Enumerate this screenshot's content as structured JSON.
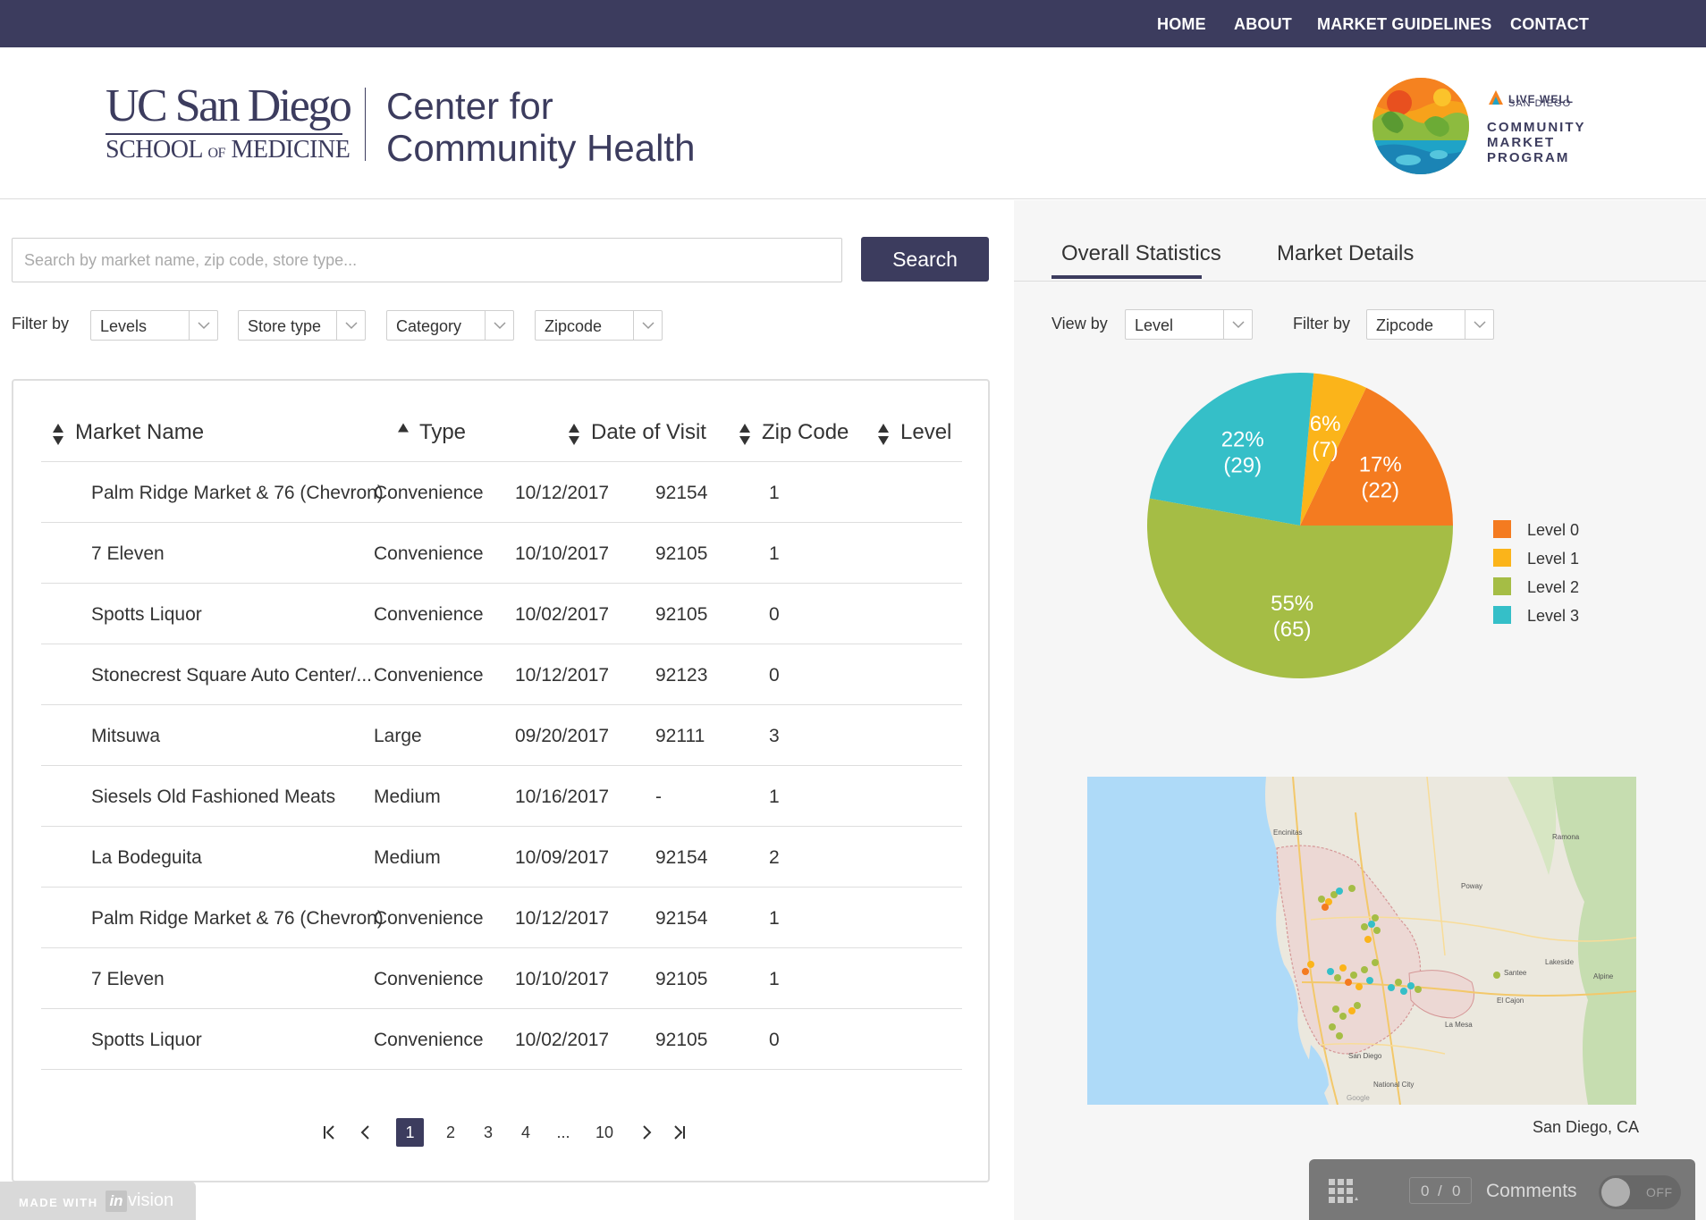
{
  "nav": {
    "items": [
      "HOME",
      "ABOUT",
      "MARKET GUIDELINES",
      "CONTACT"
    ]
  },
  "header": {
    "ucsd_title": "UC San Diego",
    "ucsd_sub_1": "SCHOOL",
    "ucsd_sub_of": "OF",
    "ucsd_sub_2": "MEDICINE",
    "cch_line1": "Center for",
    "cch_line2": "Community Health",
    "live_well": "LIVE WELL",
    "san_diego": "SAN DIEGO",
    "program_line1": "COMMUNITY",
    "program_line2": "MARKET",
    "program_line3": "PROGRAM"
  },
  "search": {
    "placeholder": "Search by market name, zip code, store type...",
    "button_label": "Search"
  },
  "filters": {
    "label": "Filter by",
    "levels": "Levels",
    "store_type": "Store type",
    "category": "Category",
    "zipcode": "Zipcode"
  },
  "table": {
    "headers": [
      "Market Name",
      "Type",
      "Date of Visit",
      "Zip Code",
      "Level"
    ],
    "rows": [
      [
        "Palm Ridge Market & 76 (Chevron)",
        "Convenience",
        "10/12/2017",
        "92154",
        "1"
      ],
      [
        "7 Eleven",
        "Convenience",
        "10/10/2017",
        "92105",
        "1"
      ],
      [
        "Spotts Liquor",
        "Convenience",
        "10/02/2017",
        "92105",
        "0"
      ],
      [
        "Stonecrest Square Auto Center/...",
        "Convenience",
        "10/12/2017",
        "92123",
        "0"
      ],
      [
        "Mitsuwa",
        "Large",
        "09/20/2017",
        "92111",
        "3"
      ],
      [
        "Siesels Old Fashioned Meats",
        "Medium",
        "10/16/2017",
        "-",
        "1"
      ],
      [
        "La Bodeguita",
        "Medium",
        "10/09/2017",
        "92154",
        "2"
      ],
      [
        "Palm Ridge Market & 76 (Chevron)",
        "Convenience",
        "10/12/2017",
        "92154",
        "1"
      ],
      [
        "7 Eleven",
        "Convenience",
        "10/10/2017",
        "92105",
        "1"
      ],
      [
        "Spotts Liquor",
        "Convenience",
        "10/02/2017",
        "92105",
        "0"
      ]
    ]
  },
  "pagination": {
    "pages": [
      "1",
      "2",
      "3",
      "4",
      "...",
      "10"
    ],
    "current": "1"
  },
  "stats": {
    "tabs": [
      "Overall Statistics",
      "Market Details"
    ],
    "active_tab": "Overall Statistics",
    "view_label": "View by",
    "view_value": "Level",
    "filter_label": "Filter by",
    "filter_value": "Zipcode"
  },
  "chart_data": {
    "type": "pie",
    "categories": [
      "Level 0",
      "Level 1",
      "Level 2",
      "Level 3"
    ],
    "values": [
      22,
      7,
      65,
      29
    ],
    "percent_labels": [
      "17%",
      "6%",
      "55%",
      "22%"
    ],
    "count_labels": [
      "(22)",
      "(7)",
      "(65)",
      "(29)"
    ],
    "colors": [
      "#f47b20",
      "#fbb41a",
      "#a5bd45",
      "#35bfc8"
    ],
    "legend_position": "right"
  },
  "map": {
    "caption": "San Diego, CA",
    "labels": {
      "city": "San Diego",
      "la_mesa": "La Mesa",
      "el_cajon": "El Cajon",
      "national_city": "National City",
      "poway": "Poway",
      "encinitas": "Encinitas",
      "santee": "Santee",
      "lakeside": "Lakeside",
      "alpine": "Alpine",
      "ramona": "Ramona",
      "google": "Google"
    }
  },
  "invision": {
    "made_with": "MADE WITH",
    "in": "in",
    "vision": "vision",
    "count_left": "0",
    "count_sep": "/",
    "count_right": "0",
    "comments": "Comments",
    "toggle": "OFF"
  },
  "colors": {
    "brand": "#3c3c5e",
    "level0": "#f47b20",
    "level1": "#fbb41a",
    "level2": "#a5bd45",
    "level3": "#35bfc8"
  }
}
